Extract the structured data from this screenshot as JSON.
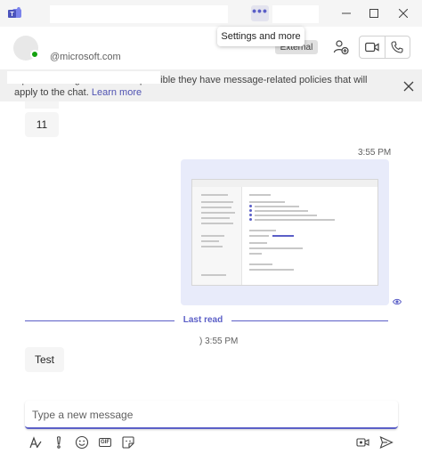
{
  "titlebar": {
    "more_dots": "•••",
    "tooltip": "Settings and more"
  },
  "header": {
    "subtitle": "@microsoft.com",
    "external_badge": "External"
  },
  "banner": {
    "text": "s part of an organization. It's possible they have message-related policies that will apply to the chat.",
    "link": "Learn more"
  },
  "messages": {
    "bubble_1": "11",
    "time_1": "3:55 PM",
    "last_read": "Last read",
    "time_2": ") 3:55 PM",
    "bubble_2": "Test"
  },
  "compose": {
    "placeholder": "Type a new message",
    "gif_label": "GIF"
  },
  "colors": {
    "accent": "#5b5fc7",
    "presence": "#13a10e",
    "bubble_bg": "#f5f5f5",
    "image_bubble_bg": "#e8ebfa"
  }
}
